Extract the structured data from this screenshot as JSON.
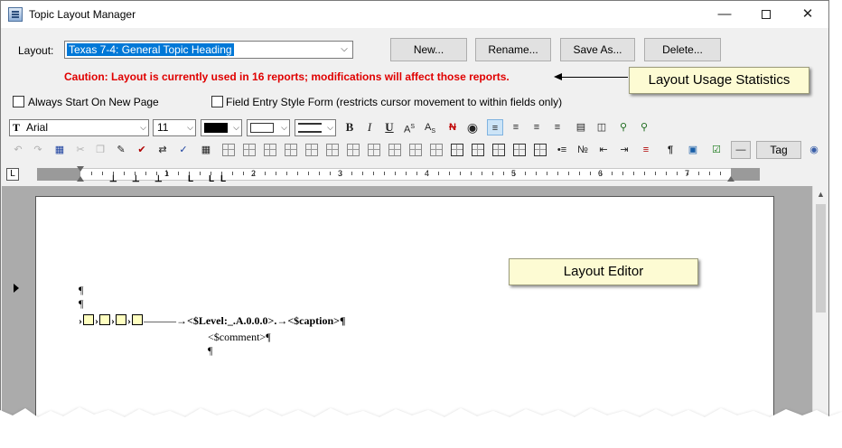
{
  "window": {
    "title": "Topic Layout Manager",
    "controls": {
      "minimize": "—",
      "close": "✕"
    }
  },
  "layout_row": {
    "label": "Layout:",
    "selected": "Texas 7-4: General Topic Heading",
    "buttons": {
      "new": "New...",
      "rename": "Rename...",
      "save_as": "Save As...",
      "delete": "Delete..."
    }
  },
  "caution": "Caution: Layout is currently used in 16 reports; modifications will affect those reports.",
  "callouts": {
    "usage": "Layout Usage Statistics",
    "editor": "Layout Editor"
  },
  "options": {
    "always_start": {
      "label": "Always Start On New Page",
      "checked": false
    },
    "field_entry": {
      "label": "Field Entry Style Form  (restricts cursor movement to within fields only)",
      "checked": false
    }
  },
  "format_toolbar": {
    "font": "Arial",
    "size": "11",
    "text_color": "#000000",
    "bold": "B",
    "italic": "I",
    "underline": "U",
    "superscript": "A",
    "subscript": "A",
    "strike": "N"
  },
  "editing_toolbar": {
    "tag_label": "Tag"
  },
  "ruler": {
    "numbers": [
      "1",
      "2",
      "3",
      "4",
      "5",
      "6",
      "7"
    ]
  },
  "document": {
    "para_mark": "¶",
    "field_line_arrow": "›",
    "level_field": "<$Level:_.A.0.0.0>.",
    "caption_field": "<$caption>¶",
    "comment_line": "<$comment>¶",
    "end_mark": "¶"
  }
}
